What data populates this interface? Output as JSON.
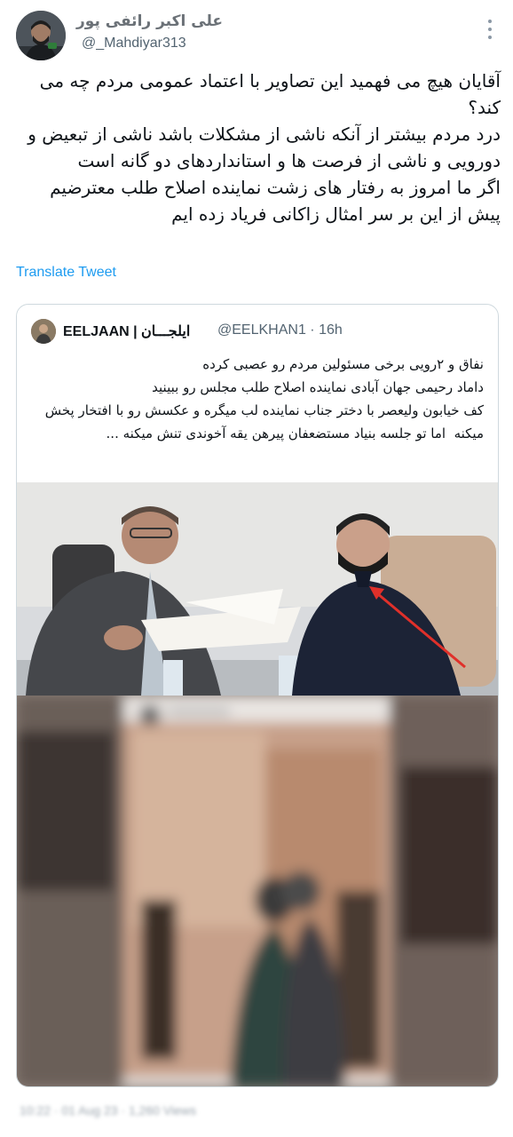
{
  "author": {
    "display_name": "علی اکبر رائفی پور",
    "handle": "@_Mahdiyar313",
    "avatar_icon": "user-avatar"
  },
  "tweet": {
    "text": "آقایان هیچ می فهمید این تصاویر با اعتماد عمومی مردم چه می کند؟\nدرد مردم بیشتر از آنکه ناشی از مشکلات باشد ناشی از تبعیض و دورویی و ناشی از فرصت ها و استانداردهای دو گانه است\nاگر ما امروز به رفتار های زشت نماینده اصلاح طلب معترضیم\nپیش از این بر سر امثال زاکانی فریاد زده ایم",
    "translate_label": "Translate Tweet",
    "more_icon": "more-options-icon"
  },
  "quoted": {
    "display_name": "EELJAAN | ایلجـــان",
    "handle": "@EELKHAN1",
    "time": "· 16h",
    "text": "نفاق و ۲رویی برخی مسئولین مردم رو عصبی کرده\nداماد رحیمی جهان آبادی نماینده اصلاح طلب مجلس رو ببینید\nکف خیابون ولیعصر با دختر جناب نماینده لب میگره و عکسش رو با افتخار پخش میکنه  اما تو جلسه بنیاد مستضعفان پیرهن یقه آخوندی تنش میکنه ..."
  },
  "footer": {
    "meta": "10:22 · 01 Aug 23 · 1,260 Views"
  },
  "colors": {
    "link": "#1d9bf0",
    "border": "#cfd9de",
    "secondary_text": "#536471",
    "arrow": "#e0302a"
  }
}
